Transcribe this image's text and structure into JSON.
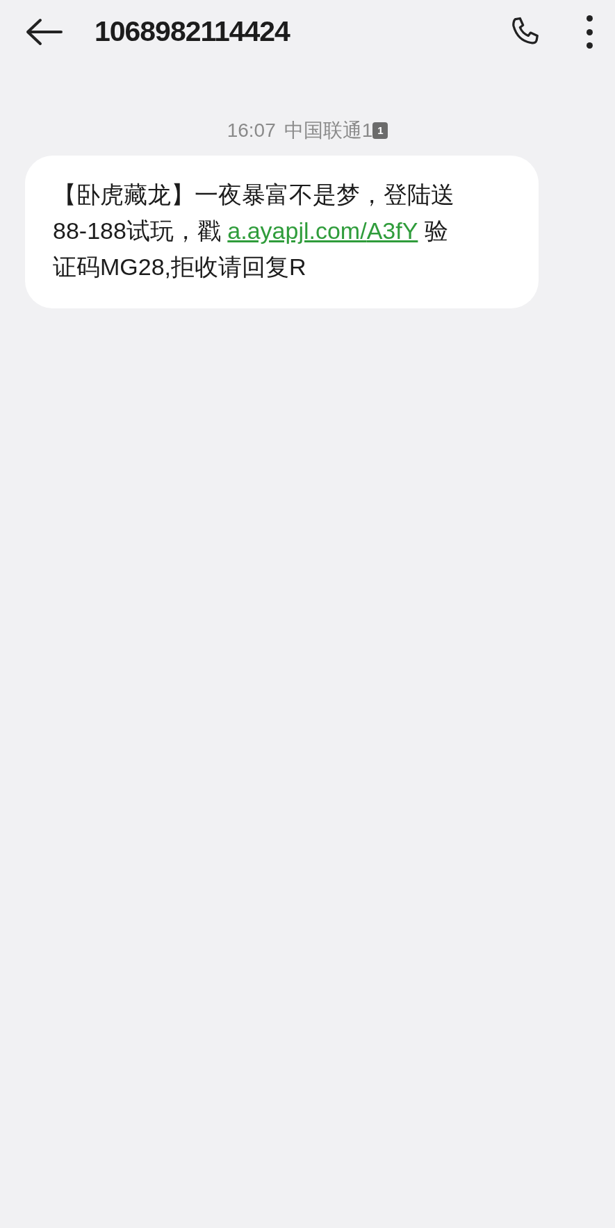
{
  "header": {
    "title": "1068982114424"
  },
  "messages": [
    {
      "time": "16:07",
      "carrier": "中国联通1",
      "sim": "1",
      "segments": [
        {
          "kind": "text",
          "text": "【卧虎藏龙】一夜暴富不是梦，登陆送88-188试玩，戳 "
        },
        {
          "kind": "link",
          "text": "a.ayapjl.com/"
        },
        {
          "kind": "link",
          "text": "A3fY"
        },
        {
          "kind": "text",
          "text": " 验证码MG28,拒收请回复R"
        }
      ]
    }
  ]
}
